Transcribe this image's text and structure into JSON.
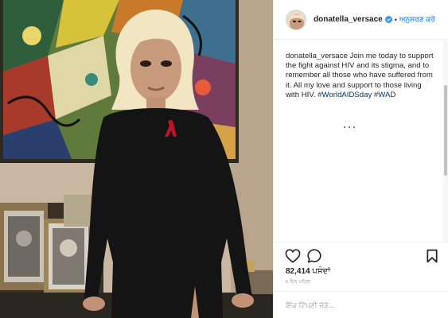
{
  "post": {
    "username": "donatella_versace",
    "follow_label": "ਅਨੁਸਰਣ ਕਰੋ",
    "separator": "•",
    "caption_user": "donatella_versace",
    "caption_text": "Join me today to support the fight against HIV and its stigma, and to remember all those who have suffered from it. All my love and support to those living with HIV.",
    "hashtags": [
      "#WorldAIDSday",
      "#WAD"
    ],
    "likes_count": "82,414",
    "likes_label": "ਪਸੰਦਾਂ",
    "time_ago": "6 ਦਿਨ ਪਹਿਲਾਂ",
    "comment_placeholder": "ਇੱਕ ਟਿੱਪਣੀ ਜੋੜੋ..."
  },
  "icons": {
    "verified": "verified-badge-icon",
    "like": "heart-icon",
    "comment": "comment-bubble-icon",
    "save": "bookmark-icon",
    "loading": "loading-dots-icon"
  },
  "colors": {
    "link_blue": "#3897f0",
    "hashtag_blue": "#003569",
    "text": "#262626",
    "muted": "#999999",
    "dress": "#141414",
    "ribbon": "#c0122a"
  }
}
